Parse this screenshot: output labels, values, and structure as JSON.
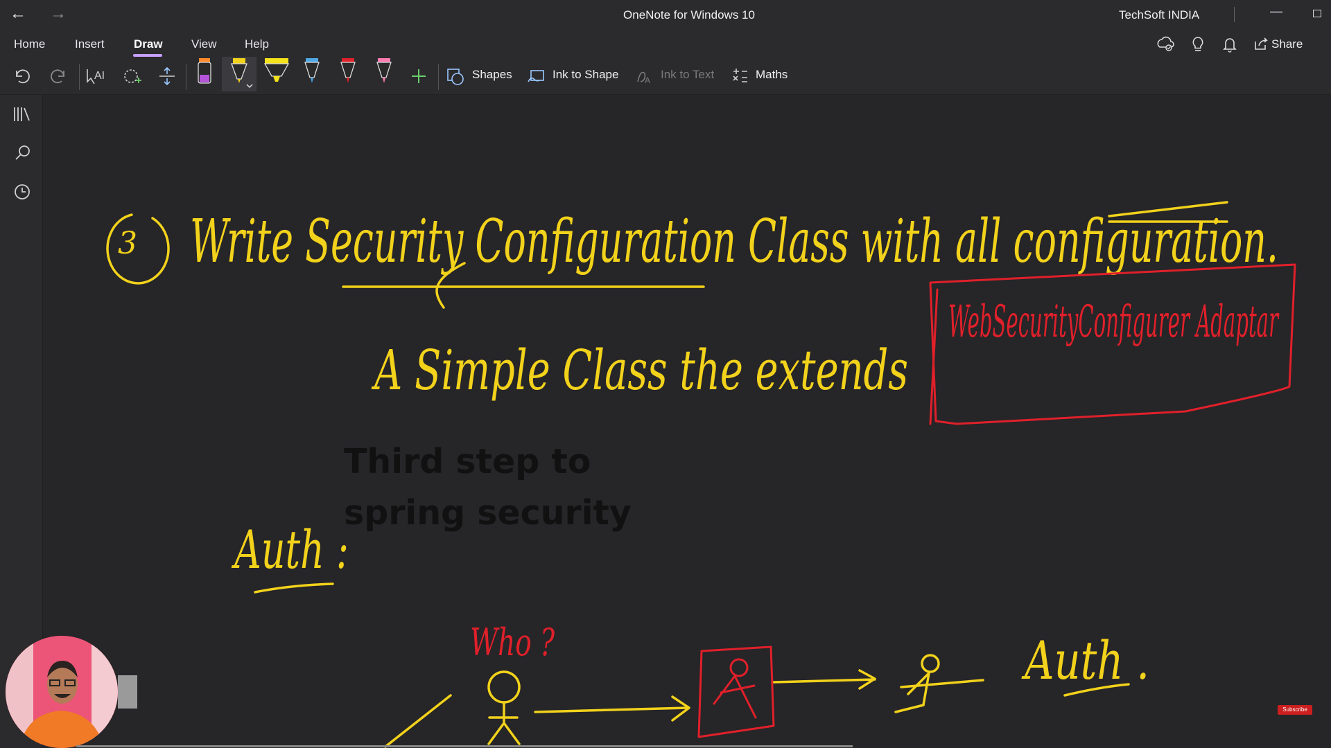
{
  "titlebar": {
    "back_icon": "back-arrow-icon",
    "forward_icon": "forward-arrow-icon",
    "title": "OneNote for Windows 10",
    "org": "TechSoft INDIA"
  },
  "menu": {
    "items": [
      {
        "label": "Home"
      },
      {
        "label": "Insert"
      },
      {
        "label": "Draw",
        "active": true
      },
      {
        "label": "View"
      },
      {
        "label": "Help"
      }
    ],
    "share_label": "Share",
    "accent_color": "#c6a0ff"
  },
  "toolbar": {
    "shapes_label": "Shapes",
    "ink_to_shape_label": "Ink to Shape",
    "ink_to_text_label": "Ink to Text",
    "maths_label": "Maths",
    "pens": [
      {
        "name": "black-pen",
        "color": "#222222"
      },
      {
        "name": "yellow-pen-selected",
        "color": "#f2d21b"
      },
      {
        "name": "yellow-highlighter",
        "color": "#f4e21a"
      },
      {
        "name": "blue-pen",
        "color": "#4fa9e6"
      },
      {
        "name": "red-pen",
        "color": "#e0202a"
      },
      {
        "name": "pink-pen",
        "color": "#ff7bb0"
      }
    ]
  },
  "page": {
    "note_title": "Third step to spring security",
    "ink_colors": {
      "yellow": "#f2d21b",
      "red": "#e0202a"
    },
    "handwriting": {
      "step_number": "3",
      "line1": "Write Security Configuration Class with all configuration.",
      "line2": "A Simple Class the extends",
      "boxed": "WebSecurityConfigurer Adaptar",
      "auth": "Auth :",
      "who": "Who ?",
      "auth2": "Auth ."
    }
  },
  "overlay": {
    "subscribe_label": "Subscribe"
  }
}
